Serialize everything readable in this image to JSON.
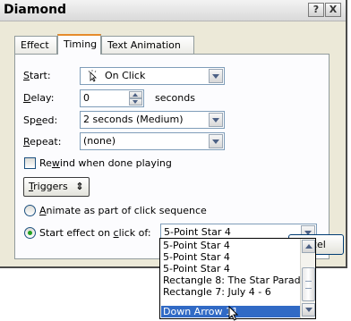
{
  "window": {
    "title": "Diamond",
    "help_button": "?",
    "close_button": "X"
  },
  "tabs": [
    {
      "label": "Effect",
      "active": false
    },
    {
      "label": "Timing",
      "active": true
    },
    {
      "label": "Text Animation",
      "active": false
    }
  ],
  "timing": {
    "start_label_u": "S",
    "start_label_rest": "tart:",
    "start_value": "On Click",
    "delay_label_u": "D",
    "delay_label_rest": "elay:",
    "delay_value": "0",
    "delay_unit": "seconds",
    "speed_label_pre": "Sp",
    "speed_label_u": "e",
    "speed_label_rest": "ed:",
    "speed_value": "2 seconds (Medium)",
    "repeat_label_u": "R",
    "repeat_label_rest": "epeat:",
    "repeat_value": "(none)",
    "rewind_label_pre": "Re",
    "rewind_label_u": "w",
    "rewind_label_rest": "ind when done playing",
    "rewind_checked": false
  },
  "triggers": {
    "button_u": "T",
    "button_rest": "riggers",
    "button_icon": "⇕",
    "animate_label_u": "A",
    "animate_label_rest": "nimate as part of click sequence",
    "animate_selected": false,
    "start_effect_label_pre": "Start effect on ",
    "start_effect_label_u": "c",
    "start_effect_label_rest": "lick of:",
    "start_effect_selected": true,
    "start_effect_value": "5-Point Star 4"
  },
  "dropdown": {
    "items": [
      "5-Point Star 4",
      "5-Point Star 4",
      "5-Point Star 4",
      "Rectangle 8: The Star Parad",
      "Rectangle 7: July 4 - 6",
      "Down Arrow 11"
    ],
    "selected_index": 5
  },
  "buttons": {
    "cancel_partial": "ncel"
  }
}
